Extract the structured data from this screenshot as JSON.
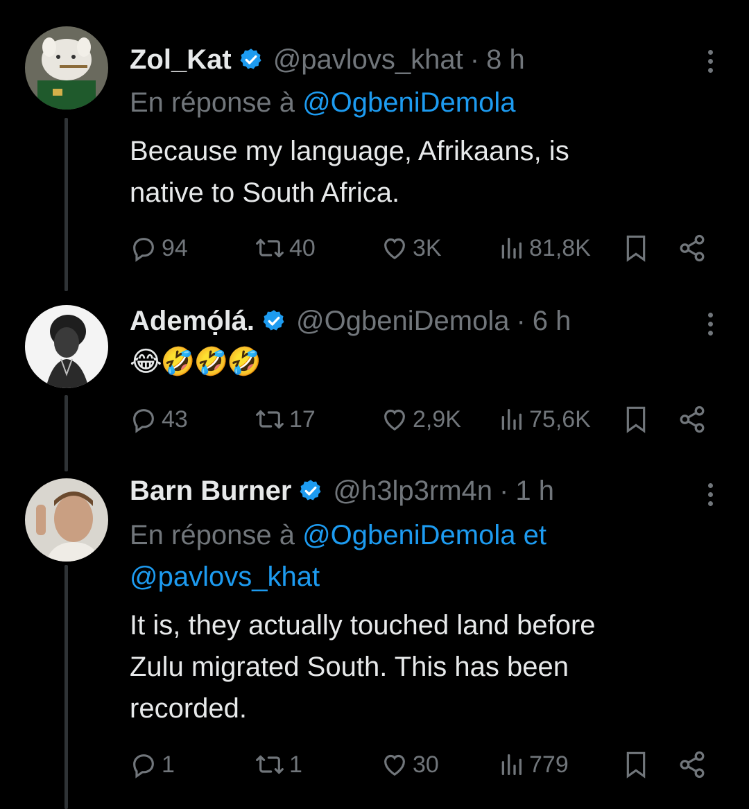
{
  "colors": {
    "background": "#000000",
    "text": "#e7e9ea",
    "muted": "#71767b",
    "link": "#1d9bf0",
    "verified": "#1d9bf0"
  },
  "tweets": [
    {
      "name": "Zol_Kat",
      "handle": "@pavlovs_khat",
      "separator": "·",
      "time": "8 h",
      "reply_prefix": "En réponse à",
      "reply_mentions": "@OgbeniDemola",
      "text_line1": "Because my language, Afrikaans, is",
      "text_line2": "native to South Africa.",
      "stats": {
        "replies": "94",
        "retweets": "40",
        "likes": "3K",
        "views": "81,8K"
      }
    },
    {
      "name": "Ademọ́lá.",
      "handle": "@OgbeniDemola",
      "separator": "·",
      "time": "6 h",
      "text_emoji": "😂🤣🤣🤣",
      "stats": {
        "replies": "43",
        "retweets": "17",
        "likes": "2,9K",
        "views": "75,6K"
      }
    },
    {
      "name": "Barn Burner",
      "handle": "@h3lp3rm4n",
      "separator": "·",
      "time": "1 h",
      "reply_prefix": "En réponse à",
      "reply_mention1": "@OgbeniDemola et",
      "reply_mention2": "@pavlovs_khat",
      "text_line1": "It is, they actually touched land before",
      "text_line2": "Zulu migrated South. This has been",
      "text_line3": "recorded.",
      "stats": {
        "replies": "1",
        "retweets": "1",
        "likes": "30",
        "views": "779"
      }
    }
  ],
  "icons": [
    "verified-badge-icon",
    "more-options-icon",
    "reply-icon",
    "retweet-icon",
    "like-icon",
    "views-icon",
    "bookmark-icon",
    "share-icon"
  ]
}
